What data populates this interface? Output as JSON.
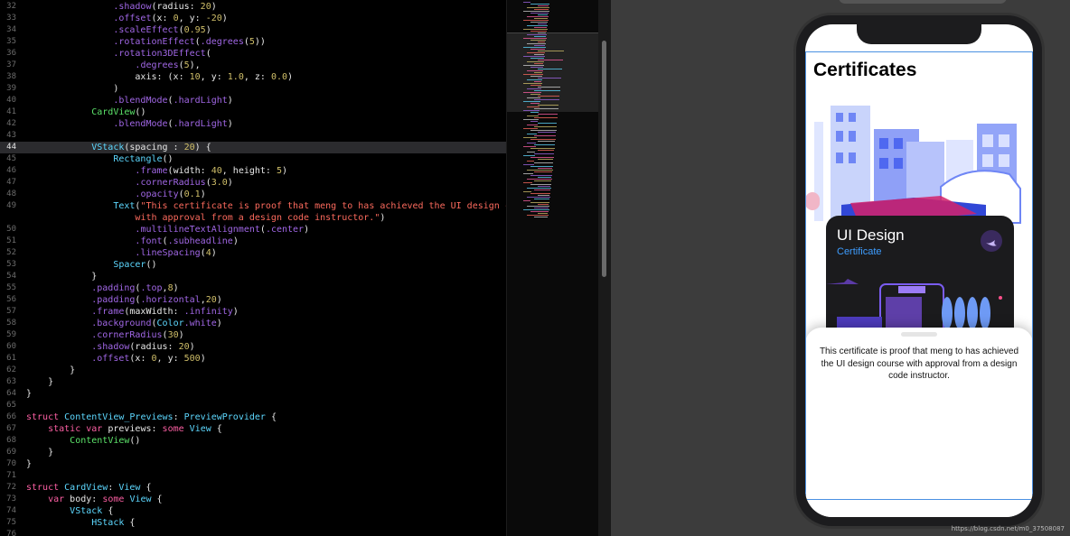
{
  "editor": {
    "lines": [
      {
        "n": "32",
        "html": "                <span class=\"mem\">.shadow</span>(radius: <span class=\"num\">20</span>)"
      },
      {
        "n": "33",
        "html": "                <span class=\"mem\">.offset</span>(x: <span class=\"num\">0</span>, y: <span class=\"num\">-20</span>)"
      },
      {
        "n": "34",
        "html": "                <span class=\"mem\">.scaleEffect</span>(<span class=\"num\">0.95</span>)"
      },
      {
        "n": "35",
        "html": "                <span class=\"mem\">.rotationEffect</span>(<span class=\"mem\">.degrees</span>(<span class=\"num\">5</span>))"
      },
      {
        "n": "36",
        "html": "                <span class=\"mem\">.rotation3DEffect</span>("
      },
      {
        "n": "37",
        "html": "                    <span class=\"mem\">.degrees</span>(<span class=\"num\">5</span>),"
      },
      {
        "n": "38",
        "html": "                    axis: (x: <span class=\"num\">10</span>, y: <span class=\"num\">1.0</span>, z: <span class=\"num\">0.0</span>)"
      },
      {
        "n": "39",
        "html": "                )"
      },
      {
        "n": "40",
        "html": "                <span class=\"mem\">.blendMode</span>(<span class=\"mem\">.hardLight</span>)"
      },
      {
        "n": "41",
        "html": "            <span class=\"grn\">CardView</span>()"
      },
      {
        "n": "42",
        "html": "                <span class=\"mem\">.blendMode</span>(<span class=\"mem\">.hardLight</span>)"
      },
      {
        "n": "43",
        "html": ""
      },
      {
        "n": "44",
        "html": "            <span class=\"ty\">VStack</span>(spacing : <span class=\"num\">20</span>) {",
        "current": true
      },
      {
        "n": "45",
        "html": "                <span class=\"ty\">Rectangle</span>()"
      },
      {
        "n": "46",
        "html": "                    <span class=\"mem\">.frame</span>(width: <span class=\"num\">40</span>, height: <span class=\"num\">5</span>)"
      },
      {
        "n": "47",
        "html": "                    <span class=\"mem\">.cornerRadius</span>(<span class=\"num\">3.0</span>)"
      },
      {
        "n": "48",
        "html": "                    <span class=\"mem\">.opacity</span>(<span class=\"num\">0.1</span>)"
      },
      {
        "n": "49",
        "html": "                <span class=\"ty\">Text</span>(<span class=\"str\">\"This certificate is proof that meng to has achieved the UI design course</span>"
      },
      {
        "n": "",
        "html": "                    <span class=\"str\">with approval from a design code instructor.\"</span>)"
      },
      {
        "n": "50",
        "html": "                    <span class=\"mem\">.multilineTextAlignment</span>(<span class=\"mem\">.center</span>)"
      },
      {
        "n": "51",
        "html": "                    <span class=\"mem\">.font</span>(<span class=\"mem\">.subheadline</span>)"
      },
      {
        "n": "52",
        "html": "                    <span class=\"mem\">.lineSpacing</span>(<span class=\"num\">4</span>)"
      },
      {
        "n": "53",
        "html": "                <span class=\"ty\">Spacer</span>()"
      },
      {
        "n": "54",
        "html": "            }"
      },
      {
        "n": "55",
        "html": "            <span class=\"mem\">.padding</span>(<span class=\"mem\">.top</span>,<span class=\"num\">8</span>)"
      },
      {
        "n": "56",
        "html": "            <span class=\"mem\">.padding</span>(<span class=\"mem\">.horizontal</span>,<span class=\"num\">20</span>)"
      },
      {
        "n": "57",
        "html": "            <span class=\"mem\">.frame</span>(maxWidth: <span class=\"mem\">.infinity</span>)"
      },
      {
        "n": "58",
        "html": "            <span class=\"mem\">.background</span>(<span class=\"ty\">Color</span><span class=\"mem\">.white</span>)"
      },
      {
        "n": "59",
        "html": "            <span class=\"mem\">.cornerRadius</span>(<span class=\"num\">30</span>)"
      },
      {
        "n": "60",
        "html": "            <span class=\"mem\">.shadow</span>(radius: <span class=\"num\">20</span>)"
      },
      {
        "n": "61",
        "html": "            <span class=\"mem\">.offset</span>(x: <span class=\"num\">0</span>, y: <span class=\"num\">500</span>)"
      },
      {
        "n": "62",
        "html": "        }"
      },
      {
        "n": "63",
        "html": "    }"
      },
      {
        "n": "64",
        "html": "}"
      },
      {
        "n": "65",
        "html": ""
      },
      {
        "n": "66",
        "html": "<span class=\"kw\">struct</span> <span class=\"ty\">ContentView_Previews</span>: <span class=\"ty\">PreviewProvider</span> {"
      },
      {
        "n": "67",
        "html": "    <span class=\"kw\">static var</span> previews: <span class=\"kw\">some</span> <span class=\"ty\">View</span> {"
      },
      {
        "n": "68",
        "html": "        <span class=\"grn\">ContentView</span>()"
      },
      {
        "n": "69",
        "html": "    }"
      },
      {
        "n": "70",
        "html": "}"
      },
      {
        "n": "71",
        "html": ""
      },
      {
        "n": "72",
        "html": "<span class=\"kw\">struct</span> <span class=\"ty\">CardView</span>: <span class=\"ty\">View</span> {"
      },
      {
        "n": "73",
        "html": "    <span class=\"kw\">var</span> body: <span class=\"kw\">some</span> <span class=\"ty\">View</span> {"
      },
      {
        "n": "74",
        "html": "        <span class=\"ty\">VStack</span> {"
      },
      {
        "n": "75",
        "html": "            <span class=\"ty\">HStack</span> {"
      },
      {
        "n": "76",
        "html": ""
      }
    ]
  },
  "preview": {
    "title": "Certificates",
    "card": {
      "title": "UI Design",
      "subtitle": "Certificate"
    },
    "sheet_text": "This certificate is proof that meng to has achieved the UI design course with approval from a design code instructor."
  },
  "watermark": "https://blog.csdn.net/m0_37508087",
  "colors": {
    "editor_bg": "#000000",
    "keyword": "#fc5fa3",
    "type": "#5dd8ff",
    "member": "#a167e6",
    "number": "#d0bf69",
    "string": "#fc6a5d",
    "canvas_bg": "#3c3c3c",
    "card_accent": "#3e9dff"
  }
}
